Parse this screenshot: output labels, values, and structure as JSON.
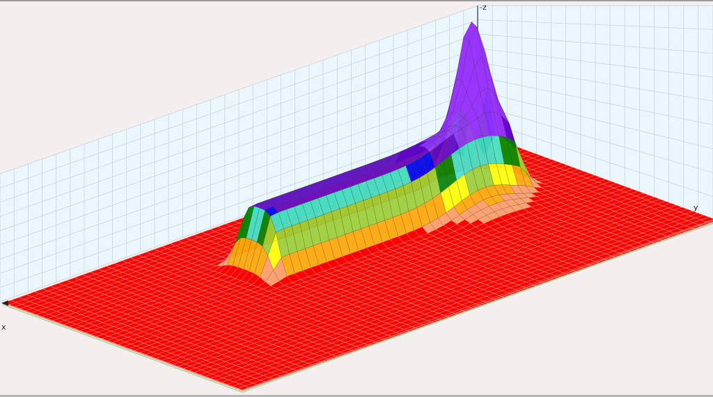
{
  "viewer": {
    "axes": {
      "x": "x",
      "y": "y",
      "z": "-z"
    }
  },
  "colors": {
    "back_wall": "#eaf6fb",
    "floor": "#f5eeee",
    "grid": "#c4cdd6",
    "surface_mesh": "#3e3e3e",
    "contour_bands": [
      "#ff0000",
      "#ff9966",
      "#ffa500",
      "#ffff00",
      "#9acd32",
      "#008000",
      "#40e0d0",
      "#0000ff",
      "#6a00cc",
      "#9933ff"
    ]
  },
  "surface": {
    "description_type": "3d-surface-contour-plot",
    "peak_band": 9
  }
}
